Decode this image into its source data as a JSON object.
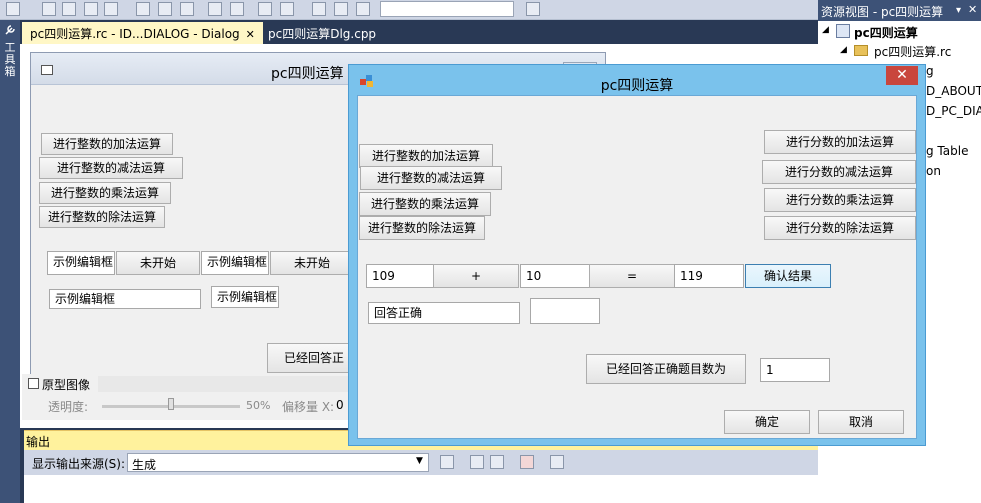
{
  "toolbox": {
    "label": "工具箱"
  },
  "tabs": [
    {
      "label": "pc四则运算.rc - ID...DIALOG - Dialog",
      "close": "✕"
    },
    {
      "label": "pc四则运算Dlg.cpp"
    }
  ],
  "designer": {
    "title": "pc四则运算",
    "int_buttons": [
      "进行整数的加法运算",
      "进行整数的减法运算",
      "进行整数的乘法运算",
      "进行整数的除法运算"
    ],
    "edit1": "示例编辑框",
    "notstart1": "未开始",
    "edit2": "示例编辑框",
    "notstart2": "未开始",
    "edit3": "示例编辑框",
    "edit4": "示例编辑框",
    "answered_prefix": "已经回答正"
  },
  "samplebar": {
    "prototype_label": "原型图像",
    "opacity_label": "透明度:",
    "opacity_value": "50%",
    "offset_label": "偏移量 X:",
    "offset_value": "0"
  },
  "output": {
    "header": "输出",
    "source_label": "显示输出来源(S):",
    "source_value": "生成"
  },
  "resource_view": {
    "title": "资源视图 - pc四则运算",
    "items": [
      "pc四则运算",
      "pc四则运算.rc",
      "g",
      "D_ABOUT",
      "D_PC_DIA",
      "g Table",
      "on"
    ]
  },
  "dialog": {
    "title": "pc四则运算",
    "close": "✕",
    "int_buttons": [
      "进行整数的加法运算",
      "进行整数的减法运算",
      "进行整数的乘法运算",
      "进行整数的除法运算"
    ],
    "frac_buttons": [
      "进行分数的加法运算",
      "进行分数的减法运算",
      "进行分数的乘法运算",
      "进行分数的除法运算"
    ],
    "operand1": "109",
    "operator": "+",
    "operand2": "10",
    "equals": "=",
    "answer": "119",
    "confirm_button": "确认结果",
    "result_text": "回答正确",
    "extra_field": "",
    "correct_count_button": "已经回答正确题目数为",
    "correct_count": "1",
    "ok_button": "确定",
    "cancel_button": "取消"
  },
  "colors": {
    "ide_background": "#293955",
    "dialog_frame": "#7ac2ec",
    "close_button": "#c9463d",
    "output_header": "#fff29d"
  }
}
